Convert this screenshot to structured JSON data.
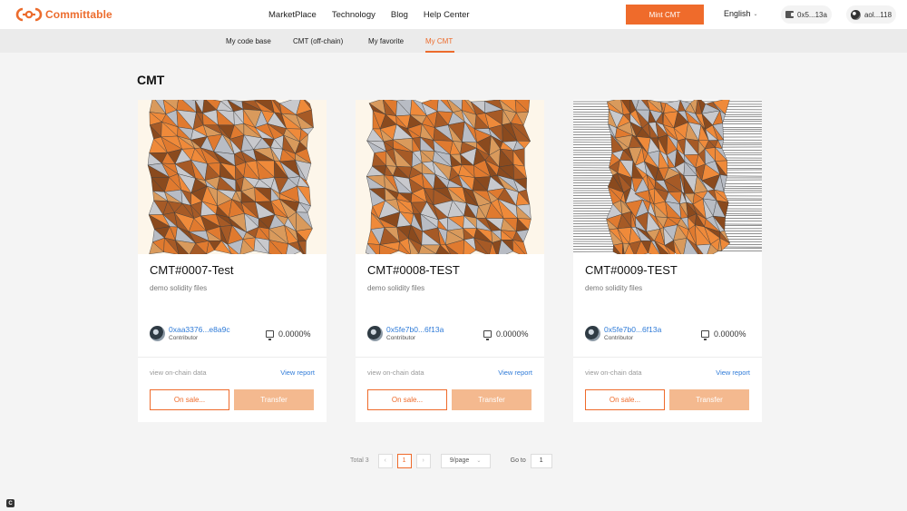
{
  "brand": {
    "name": "Committable",
    "accent": "#ec6c2d"
  },
  "nav": {
    "items": [
      "MarketPlace",
      "Technology",
      "Blog",
      "Help Center"
    ]
  },
  "header": {
    "mint_label": "Mint CMT",
    "language": "English",
    "wallet_label": "0x5...13a",
    "account_label": "aol...118"
  },
  "subnav": {
    "tabs": [
      "My code base",
      "CMT (off-chain)",
      "My favorite",
      "My CMT"
    ],
    "active": "My CMT"
  },
  "section_title": "CMT",
  "cards": [
    {
      "title": "CMT#0007-Test",
      "description": "demo solidity files",
      "contributor_address": "0xaa3376...e8a9c",
      "contributor_role": "Contributor",
      "share": "0.0000%",
      "chain_link": "view on-chain data",
      "report_link": "View report",
      "sale_label": "On sale...",
      "transfer_label": "Transfer"
    },
    {
      "title": "CMT#0008-TEST",
      "description": "demo solidity files",
      "contributor_address": "0x5fe7b0...6f13a",
      "contributor_role": "Contributor",
      "share": "0.0000%",
      "chain_link": "view on-chain data",
      "report_link": "View report",
      "sale_label": "On sale...",
      "transfer_label": "Transfer"
    },
    {
      "title": "CMT#0009-TEST",
      "description": "demo solidity files",
      "contributor_address": "0x5fe7b0...6f13a",
      "contributor_role": "Contributor",
      "share": "0.0000%",
      "chain_link": "view on-chain data",
      "report_link": "View report",
      "sale_label": "On sale...",
      "transfer_label": "Transfer"
    }
  ],
  "pagination": {
    "total_label": "Total 3",
    "prev": "‹",
    "current_page": "1",
    "next": "›",
    "page_size": "9/page",
    "goto_label": "Go to",
    "goto_value": "1"
  }
}
